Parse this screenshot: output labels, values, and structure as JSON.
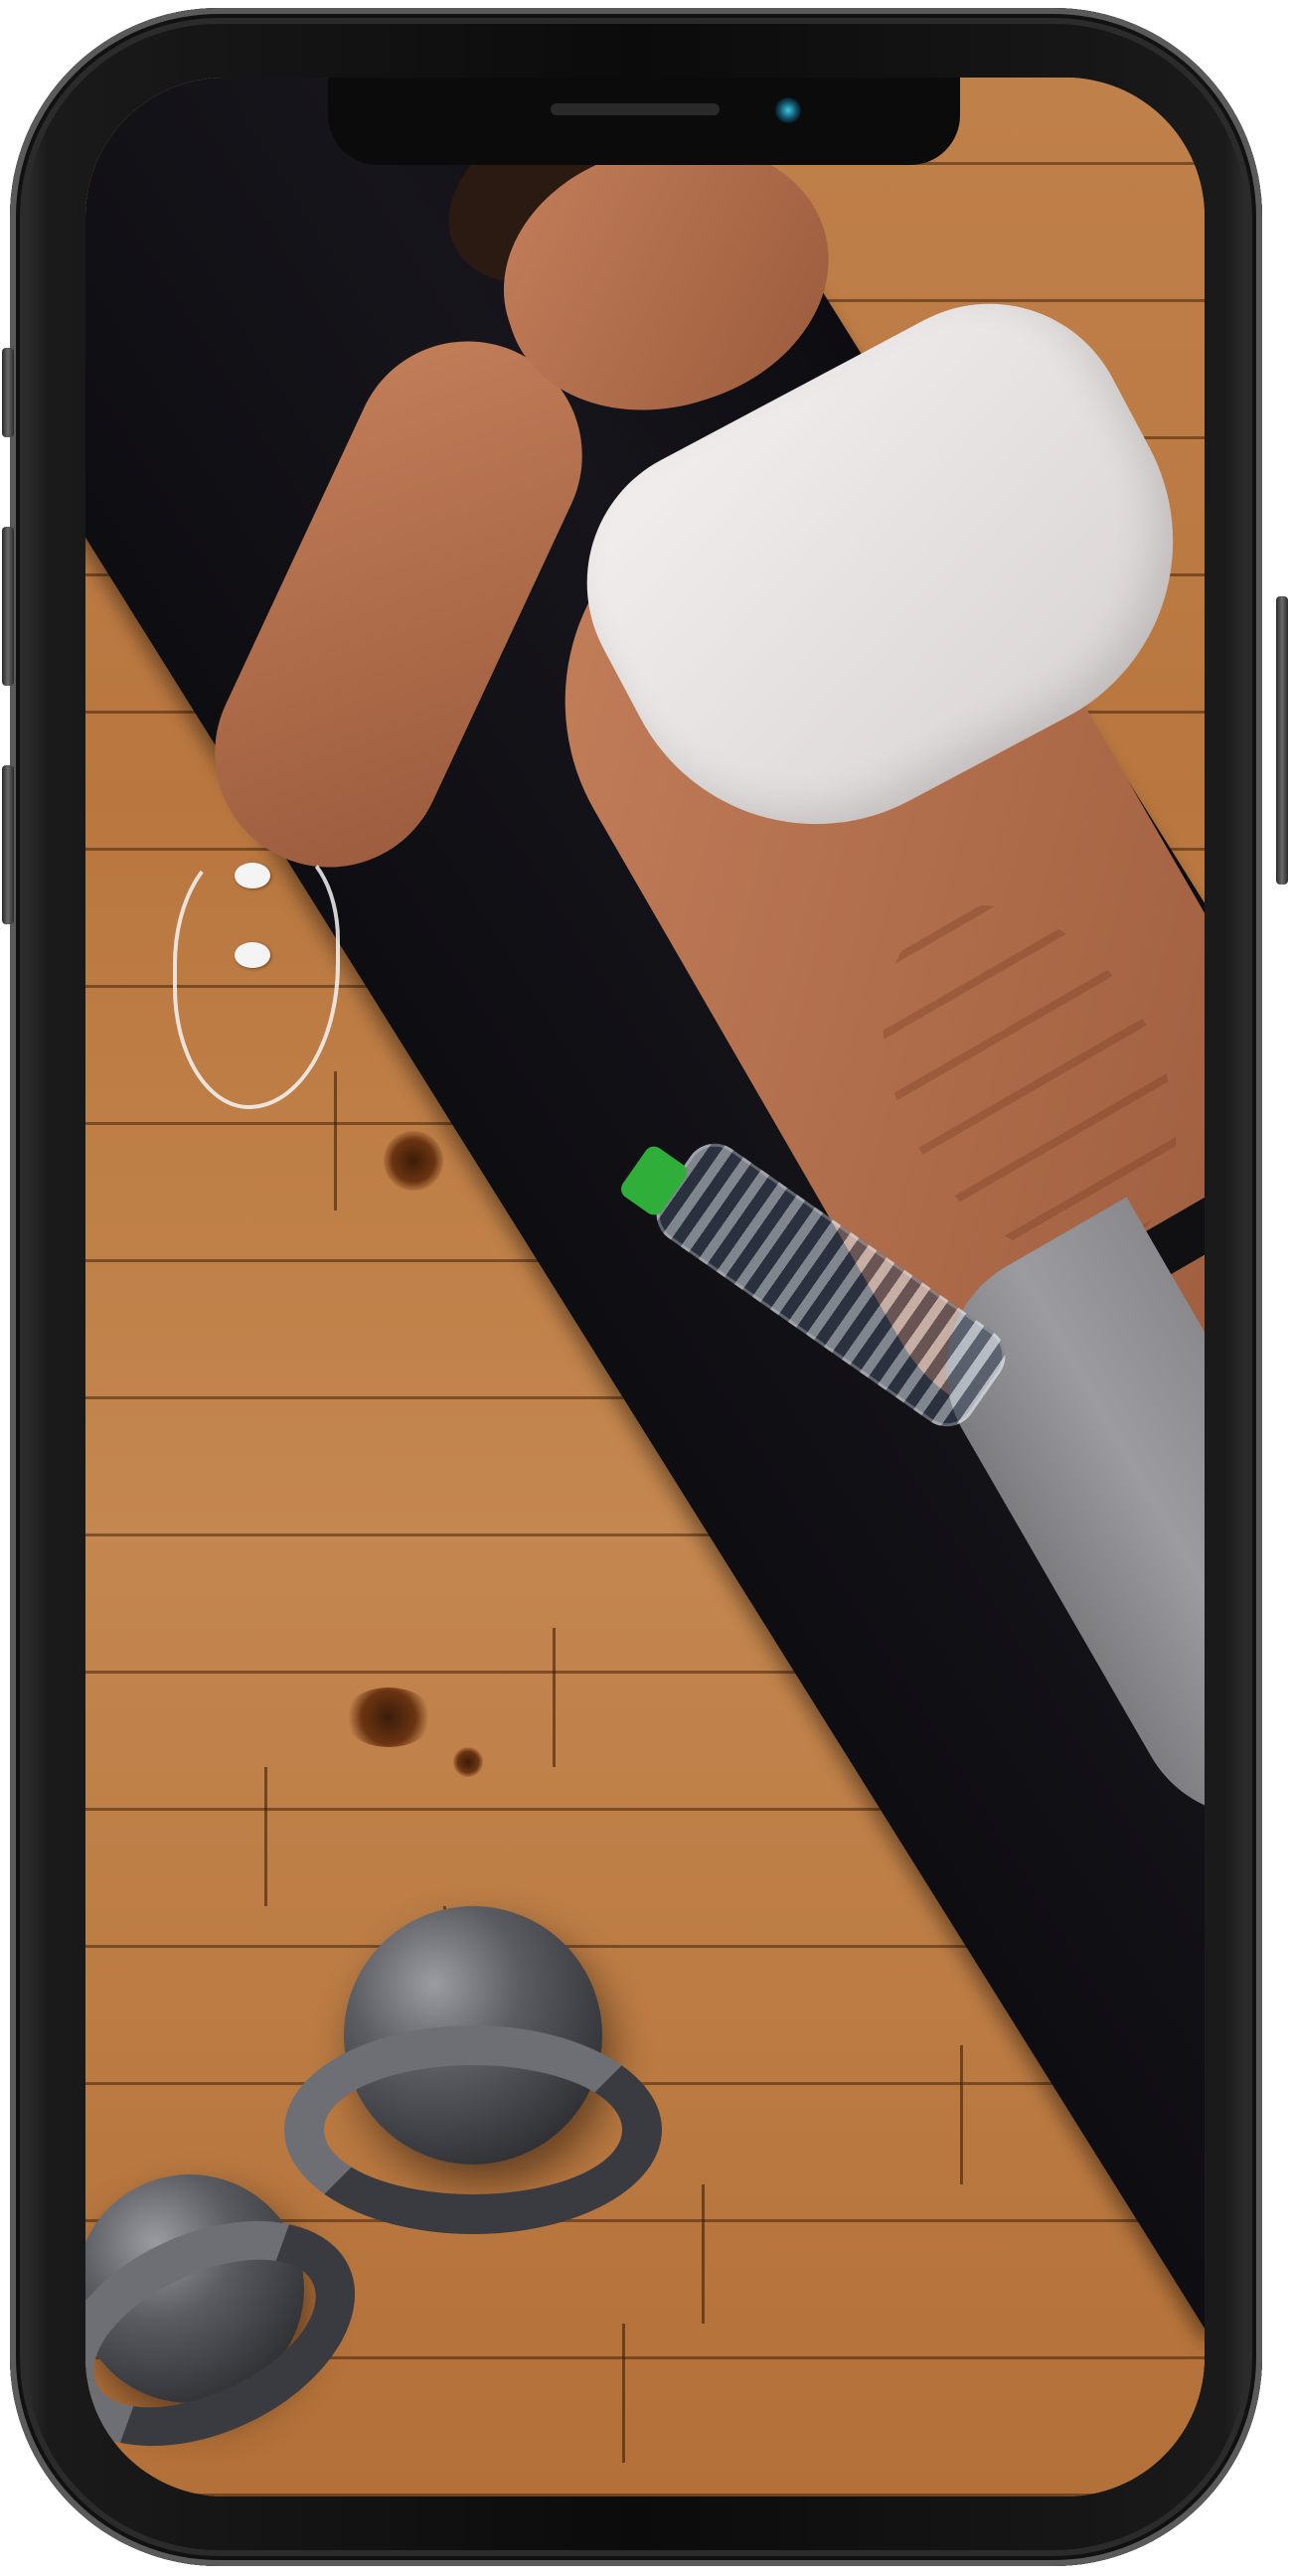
{
  "device": {
    "model": "phone",
    "frame_color": "#0b0b0b",
    "screen_content": "fitness-photo"
  },
  "screen": {
    "wallpaper": {
      "background_color": "#b9773e",
      "mat_color": "#111016",
      "bottle_cap_color": "#2fae3a"
    }
  },
  "icons": [
    "camera-icon",
    "speaker-icon"
  ]
}
